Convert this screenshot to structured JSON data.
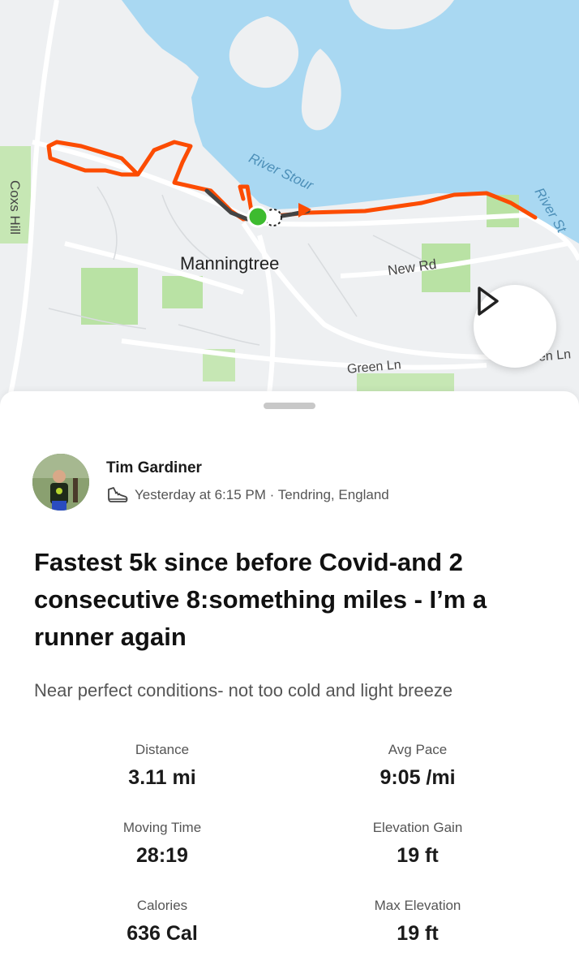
{
  "map": {
    "labels": {
      "town": "Manningtree",
      "river_main": "River Stour",
      "river_edge": "River St",
      "road_coxs": "Coxs Hill",
      "road_new": "New Rd",
      "road_green": "Green Ln",
      "road_green_right": "en Ln"
    },
    "route_color": "#fc4c02",
    "start_marker_color": "#3dbb2f",
    "water_color": "#a9d8f2",
    "park_color": "#b9e2a4"
  },
  "controls": {
    "play_icon": "play-icon"
  },
  "athlete": {
    "name": "Tim Gardiner",
    "sport_icon": "shoe-icon",
    "meta": "Yesterday at 6:15 PM · Tendring, England"
  },
  "activity": {
    "title": "Fastest 5k since before Covid-and 2 consecutive 8:something miles  - I’m a runner again",
    "description": "Near perfect conditions- not too cold and light breeze"
  },
  "stats": [
    {
      "label": "Distance",
      "value": "3.11 mi"
    },
    {
      "label": "Avg Pace",
      "value": "9:05 /mi"
    },
    {
      "label": "Moving Time",
      "value": "28:19"
    },
    {
      "label": "Elevation Gain",
      "value": "19 ft"
    },
    {
      "label": "Calories",
      "value": "636 Cal"
    },
    {
      "label": "Max Elevation",
      "value": "19 ft"
    }
  ]
}
